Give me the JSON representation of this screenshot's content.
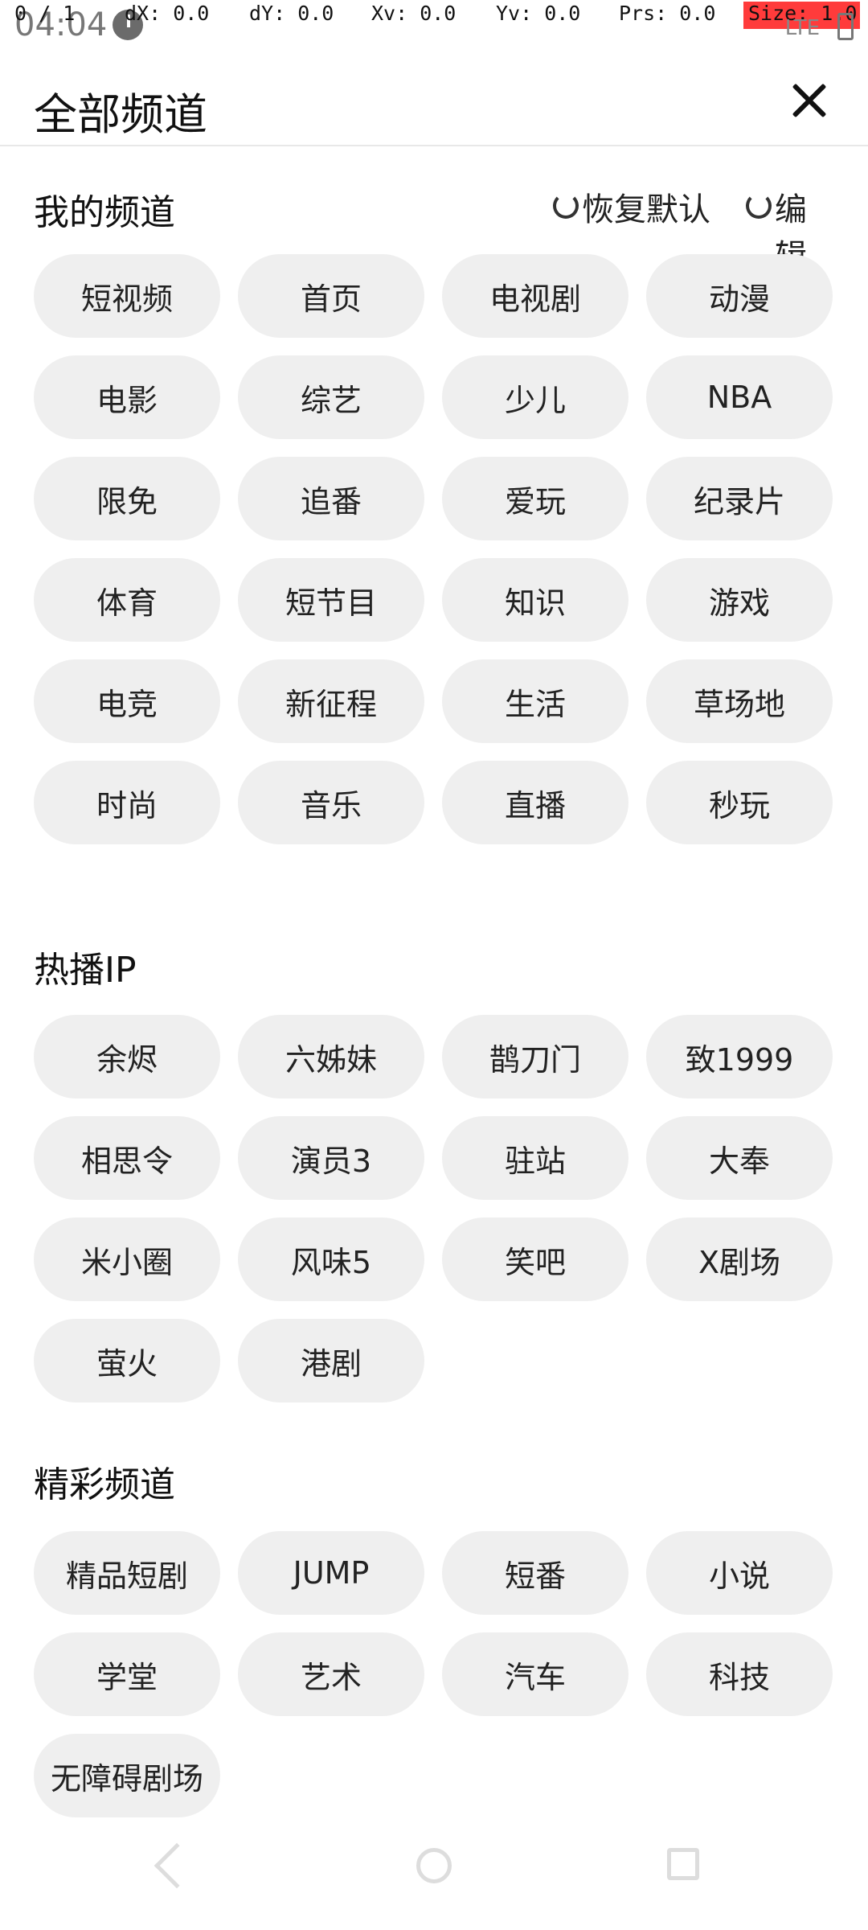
{
  "status": {
    "time": "04:04",
    "pointer": "0 / 1",
    "dx": "dX: 0.0",
    "dy": "dY: 0.0",
    "xv": "Xv: 0.0",
    "yv": "Yv: 0.0",
    "prs": "Prs: 0.0",
    "size": "Size: 1.0",
    "network": "LTE",
    "debug_color": "#ff3b3b"
  },
  "header": {
    "title": "全部频道"
  },
  "my_channels": {
    "title": "我的频道",
    "restore_label": "恢复默认",
    "edit_label": "编辑",
    "items": [
      "短视频",
      "首页",
      "电视剧",
      "动漫",
      "电影",
      "综艺",
      "少儿",
      "NBA",
      "限免",
      "追番",
      "爱玩",
      "纪录片",
      "体育",
      "短节目",
      "知识",
      "游戏",
      "电竞",
      "新征程",
      "生活",
      "草场地",
      "时尚",
      "音乐",
      "直播",
      "秒玩"
    ]
  },
  "hot_ip": {
    "title": "热播IP",
    "items": [
      "余烬",
      "六姊妹",
      "鹊刀门",
      "致1999",
      "相思令",
      "演员3",
      "驻站",
      "大奉",
      "米小圈",
      "风味5",
      "笑吧",
      "X剧场",
      "萤火",
      "港剧"
    ]
  },
  "featured": {
    "title": "精彩频道",
    "items": [
      "精品短剧",
      "JUMP",
      "短番",
      "小说",
      "学堂",
      "艺术",
      "汽车",
      "科技",
      "无障碍剧场"
    ]
  },
  "colors": {
    "chip_bg": "#efefef",
    "text": "#222222"
  }
}
